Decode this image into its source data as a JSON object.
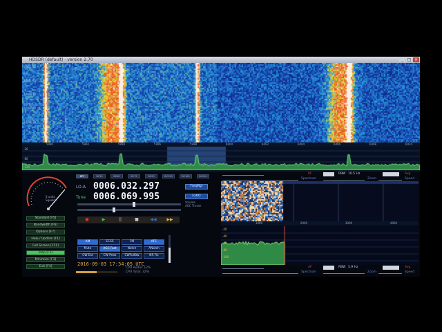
{
  "window": {
    "title": "HDSDR (default) - version 2.70",
    "controls": [
      "_",
      "□",
      "×"
    ]
  },
  "waterfall": {
    "freq_ticks": [
      "5990",
      "5992",
      "5994",
      "5996",
      "5998",
      "6000",
      "6002",
      "6004",
      "6006",
      "6008",
      "6010"
    ],
    "time_labels": [
      "17:33:50",
      "17:33:40",
      "17:33:30",
      "17:33:20",
      "17:33:10"
    ],
    "spectrum_scale": [
      "-20",
      "-80",
      "-120"
    ]
  },
  "smeter": {
    "label": "S units\nSquelch"
  },
  "menu": [
    {
      "label": "Standard  [F5]",
      "active": false
    },
    {
      "label": "Bandwidth  [F6]",
      "active": false
    },
    {
      "label": "Options  [F7]",
      "active": false
    },
    {
      "label": "Help / Update  [F1]",
      "active": false
    },
    {
      "label": "Full Screen  [F11]",
      "active": false
    },
    {
      "label": "Stop  [F2]",
      "active": true
    },
    {
      "label": "Minimize  [F3]",
      "active": false
    },
    {
      "label": "Exit  [F4]",
      "active": false
    }
  ],
  "band_tabs": [
    "BPF",
    "BC50",
    "BC60",
    "BC75",
    "BC90",
    "BC120",
    "BC160",
    "BC200"
  ],
  "lo": {
    "label": "LO-A",
    "value": "0006.032.297"
  },
  "tune": {
    "label": "Tune",
    "value": "0006.069.995"
  },
  "buttons": {
    "freqmgr": "FreqMgr",
    "extio": "ExtIO"
  },
  "labels": {
    "volume": "Volume",
    "agc_thresh": "AGC Thresh"
  },
  "transport": [
    "●",
    "▶",
    "||",
    "■",
    "◀◀",
    "▶▶"
  ],
  "modes_row1": [
    {
      "label": "AM",
      "sel": true
    },
    {
      "label": "ECSS",
      "sel": false
    },
    {
      "label": "FM",
      "sel": false
    },
    {
      "label": "AFC",
      "sel": true
    }
  ],
  "modes_row2": [
    {
      "label": "Mute",
      "sel": false
    },
    {
      "label": "AGC Fast",
      "sel": true
    },
    {
      "label": "Notch",
      "sel": false
    },
    {
      "label": "ANotch",
      "sel": false
    }
  ],
  "modes_row3": [
    {
      "label": "CW Ext",
      "sel": false
    },
    {
      "label": "CW Peak",
      "sel": false
    },
    {
      "label": "CWFullBw",
      "sel": false
    },
    {
      "label": "NR Fix",
      "sel": false
    }
  ],
  "datetime": "2016-09-03  17:34:05 UTC",
  "cpu": {
    "audio": "CPU Audio:  12%",
    "total": "CPU Total:  32%"
  },
  "levels": {
    "volume": 0.55,
    "agc": 0.35
  },
  "rf_controls": {
    "rf_label": "RF",
    "bw_label": "RBW",
    "bw_value": "10.5 Hz",
    "avg_label": "Avg",
    "spectrum": "Spectrum",
    "zoom": "Zoom",
    "speed": "Speed"
  },
  "af_controls": {
    "rf_label": "AF",
    "bw_label": "RBW",
    "bw_value": "5.9 Hz",
    "avg_label": "Avg",
    "spectrum": "Spectrum",
    "zoom": "Zoom",
    "speed": "Speed"
  },
  "zoom_axis": [
    "1000",
    "2000",
    "3000",
    "4000"
  ],
  "zoom_scale": [
    "-20",
    "-40",
    "-60",
    "-80",
    "-100"
  ],
  "colors": {
    "accent": "#2d6bd0",
    "lcd": "#f3f6ff",
    "active_green": "#46c85a",
    "time": "#d9a94b"
  }
}
